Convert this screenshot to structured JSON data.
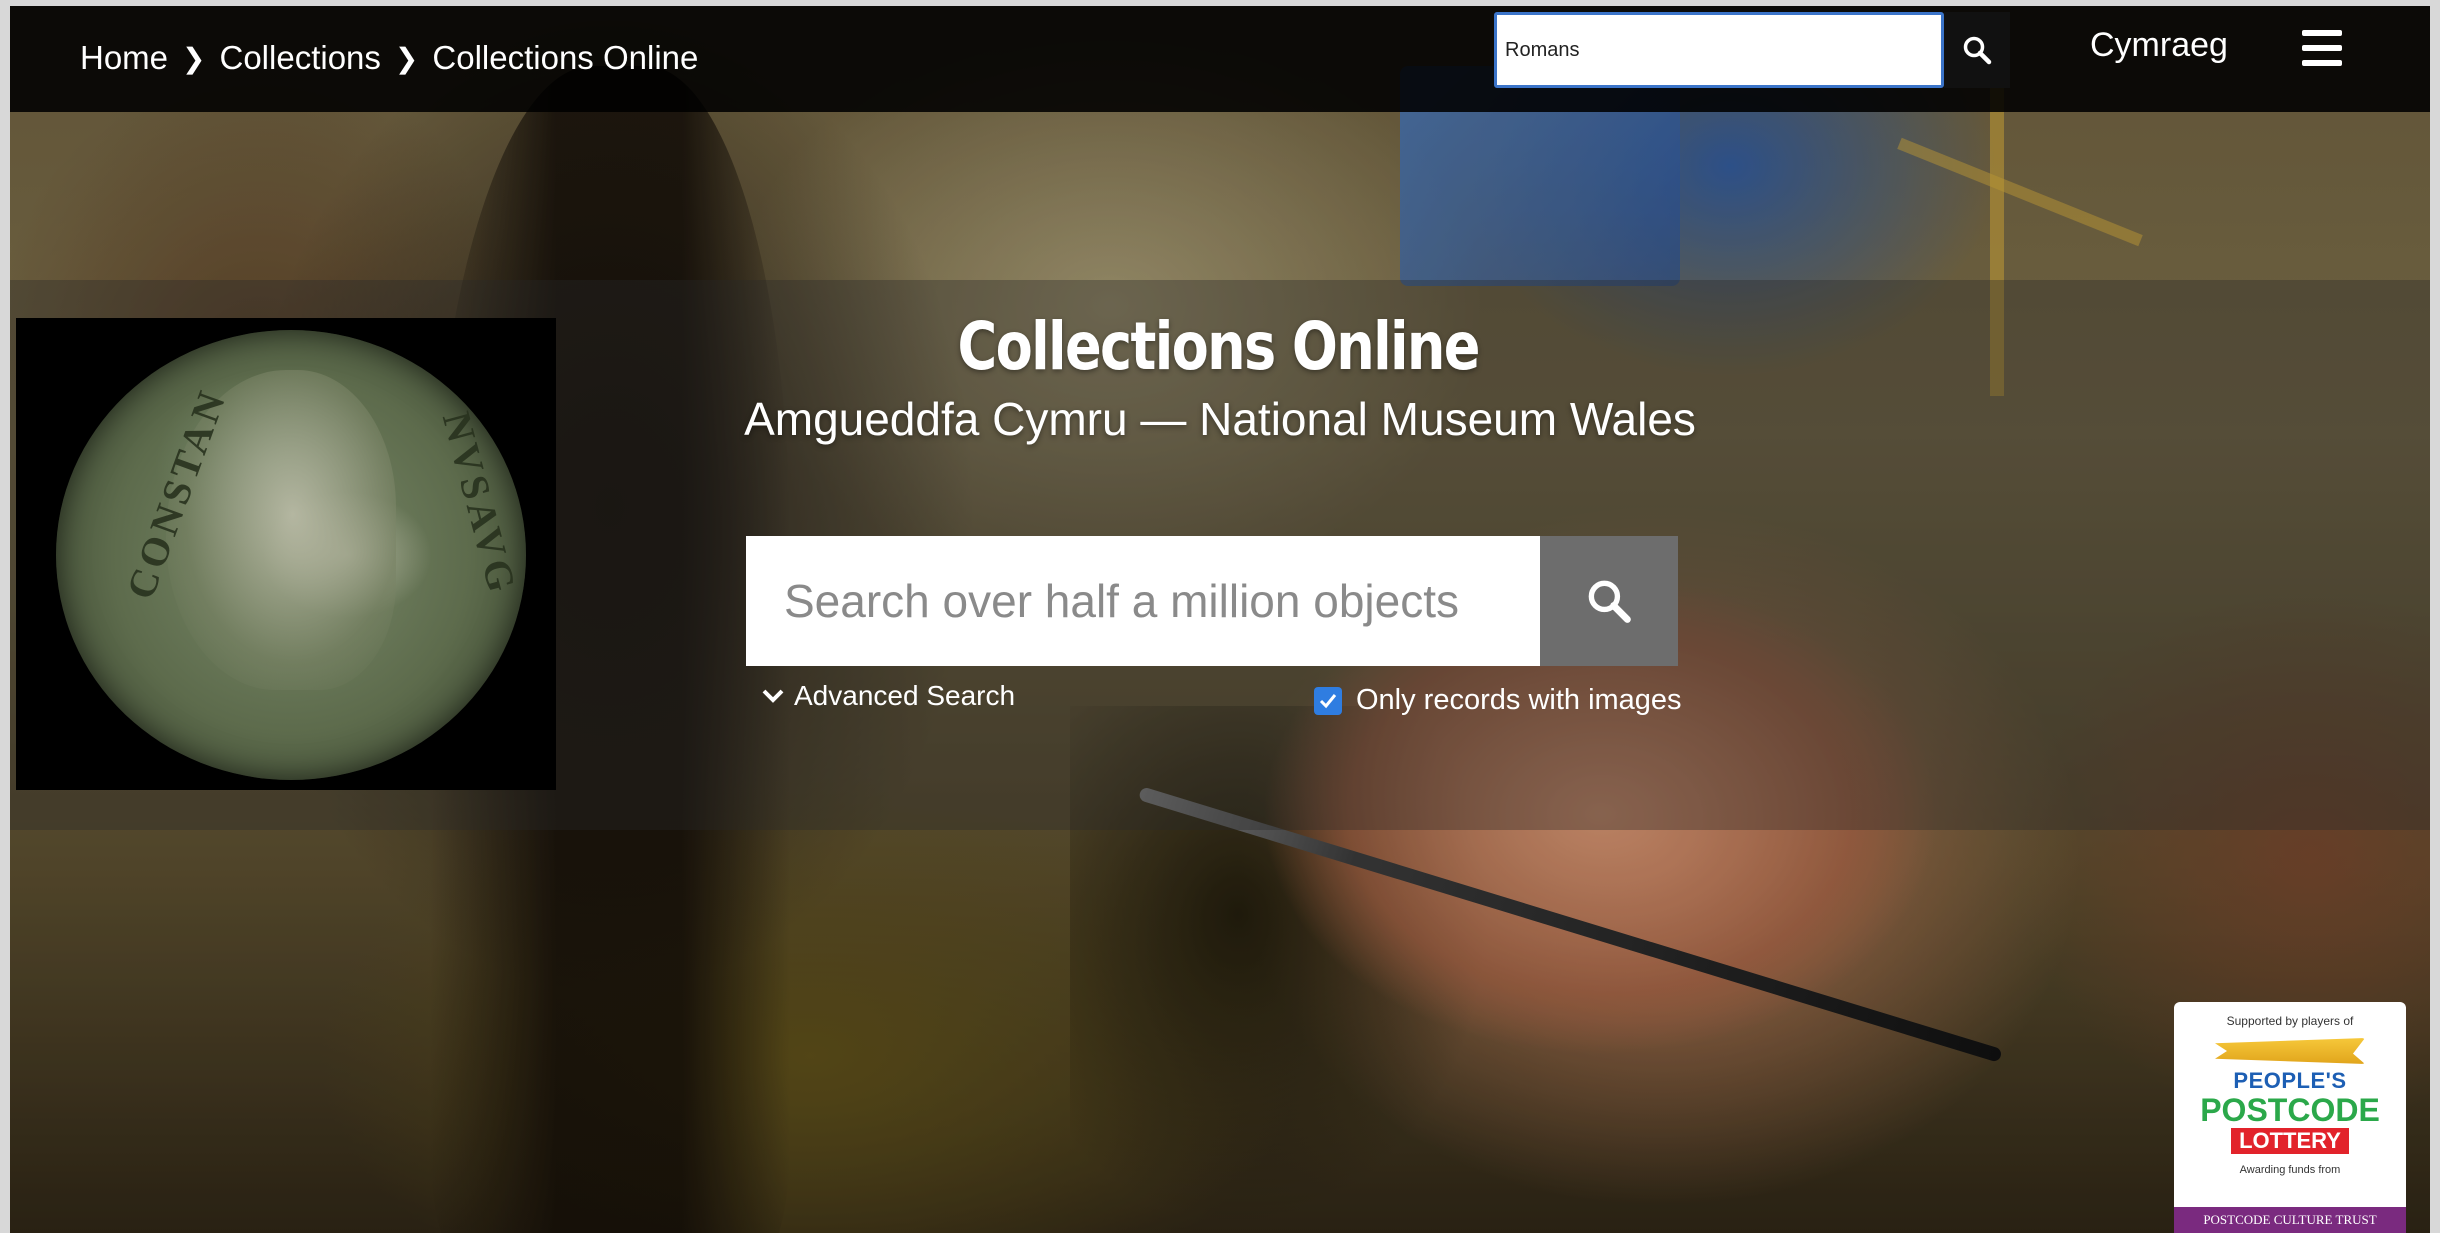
{
  "breadcrumb": {
    "items": [
      {
        "label": "Home"
      },
      {
        "label": "Collections"
      },
      {
        "label": "Collections Online"
      }
    ]
  },
  "header": {
    "search_value": "Romans",
    "language_link": "Cymraeg",
    "icons": {
      "search": "search-icon",
      "menu": "hamburger-menu-icon"
    }
  },
  "hero": {
    "title": "Collections Online",
    "subtitle": "Amgueddfa Cymru — National Museum Wales",
    "search_placeholder": "Search over half a million objects",
    "advanced_search_label": "Advanced Search",
    "only_images_label": "Only records with images",
    "only_images_checked": true
  },
  "featured_image": {
    "description_icon": "roman-coin-image",
    "legend_left": "CONSTAN",
    "legend_right": "NVSAVG"
  },
  "sponsor": {
    "supported_by": "Supported by players of",
    "line1": "PEOPLE'S",
    "line2": "POSTCODE",
    "line3": "LOTTERY",
    "awarding": "Awarding funds from",
    "trust": "POSTCODE CULTURE TRUST"
  },
  "colors": {
    "topbar": "#000000",
    "search_border": "#3b74c9",
    "checkbox": "#2f7de1",
    "main_search_button": "#6d6d6d"
  }
}
